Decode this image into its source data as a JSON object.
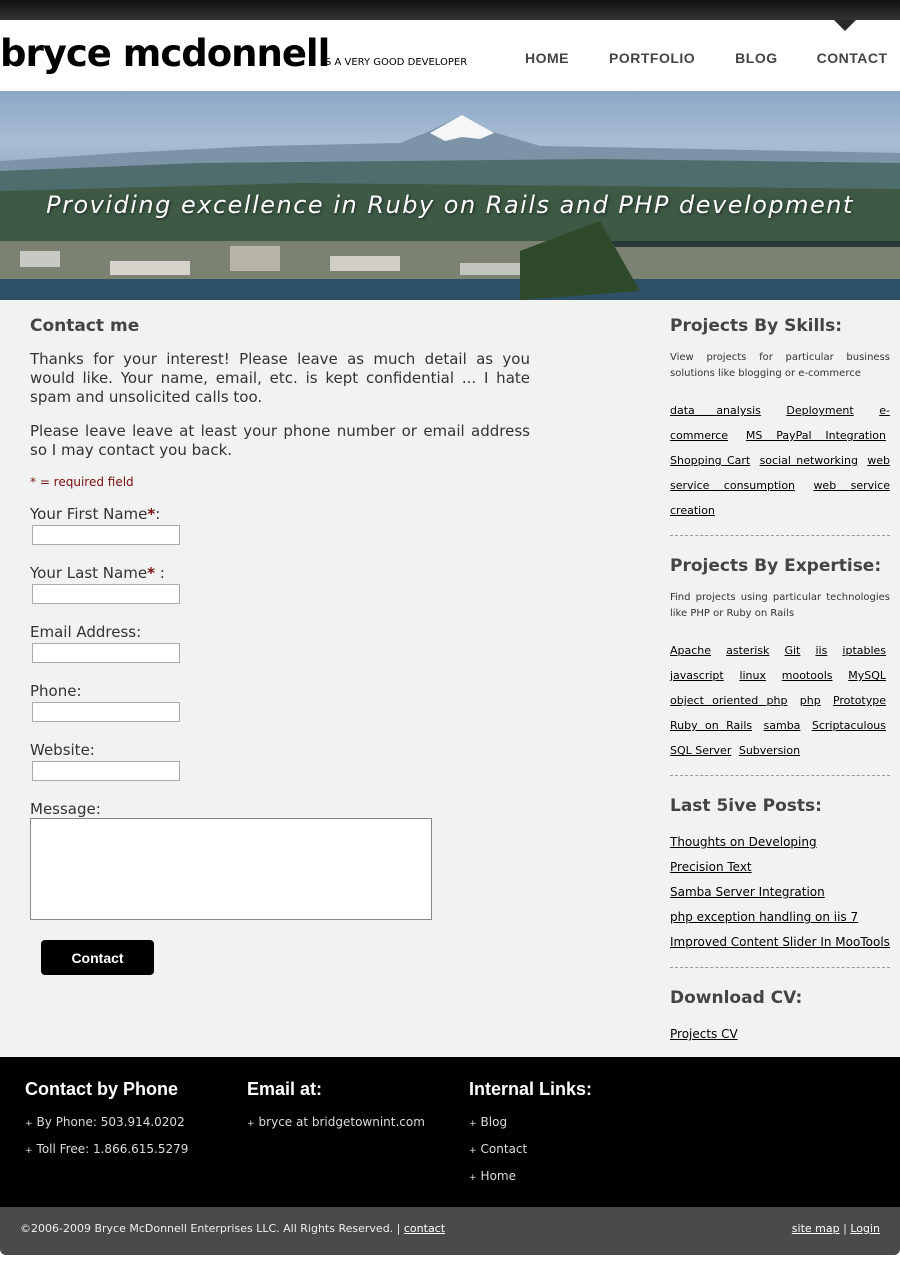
{
  "header": {
    "logo": "bryce mcdonnell",
    "tagline": "IS A VERY GOOD DEVELOPER",
    "nav": [
      {
        "label": "HOME"
      },
      {
        "label": "PORTFOLIO"
      },
      {
        "label": "BLOG"
      },
      {
        "label": "CONTACT",
        "active": true
      }
    ]
  },
  "banner": {
    "text": "Providing excellence in Ruby on Rails and PHP development"
  },
  "main": {
    "title": "Contact me",
    "intro1": "Thanks for your interest! Please leave as much detail as you would like. Your name, email, etc. is kept confidential ... I hate spam and unsolicited calls too.",
    "intro2": "Please leave leave at least your phone number or email address so I may contact you back.",
    "required_note": "* = required field",
    "form": {
      "first_name_label": "Your First Name",
      "first_name_suffix": ":",
      "last_name_label": "Your Last Name",
      "last_name_suffix": " :",
      "email_label": "Email Address:",
      "phone_label": "Phone:",
      "website_label": "Website:",
      "message_label": "Message:",
      "required_star": "*",
      "submit_label": "Contact"
    }
  },
  "sidebar": {
    "skills": {
      "title": "Projects By Skills:",
      "desc": "View projects for particular business solutions like blogging or e-commerce",
      "tags": [
        "data analysis",
        "Deployment",
        "e-commerce",
        "MS PayPal Integration",
        "Shopping Cart",
        "social networking",
        "web service consumption",
        "web service creation"
      ]
    },
    "expertise": {
      "title": "Projects By Expertise:",
      "desc": "Find projects using particular technologies like PHP or Ruby on Rails",
      "tags": [
        "Apache",
        "asterisk",
        "Git",
        "iis",
        "iptables",
        "javascript",
        "linux",
        "mootools",
        "MySQL",
        "object oriented php",
        "php",
        "Prototype",
        "Ruby on Rails",
        "samba",
        "Scriptaculous",
        "SQL Server",
        "Subversion"
      ]
    },
    "posts": {
      "title": "Last 5ive Posts:",
      "items": [
        "Thoughts on Developing",
        "Precision Text",
        "Samba Server Integration",
        "php exception handling on iis 7",
        "Improved Content Slider In MooTools"
      ]
    },
    "cv": {
      "title": "Download CV:",
      "link": "Projects CV"
    }
  },
  "footer": {
    "phone": {
      "title": "Contact by Phone",
      "items": [
        "By Phone: 503.914.0202",
        "Toll Free: 1.866.615.5279"
      ]
    },
    "email": {
      "title": "Email at:",
      "items": [
        "bryce at bridgetownint.com"
      ]
    },
    "links": {
      "title": "Internal Links:",
      "items": [
        "Blog",
        "Contact",
        "Home"
      ]
    },
    "plus_glyph": "+"
  },
  "bottom": {
    "copyright": "©2006-2009 Bryce McDonnell Enterprises LLC. All Rights Reserved. |",
    "contact_link": "contact",
    "sitemap_link": "site map",
    "separator": "|",
    "login_link": "Login"
  }
}
